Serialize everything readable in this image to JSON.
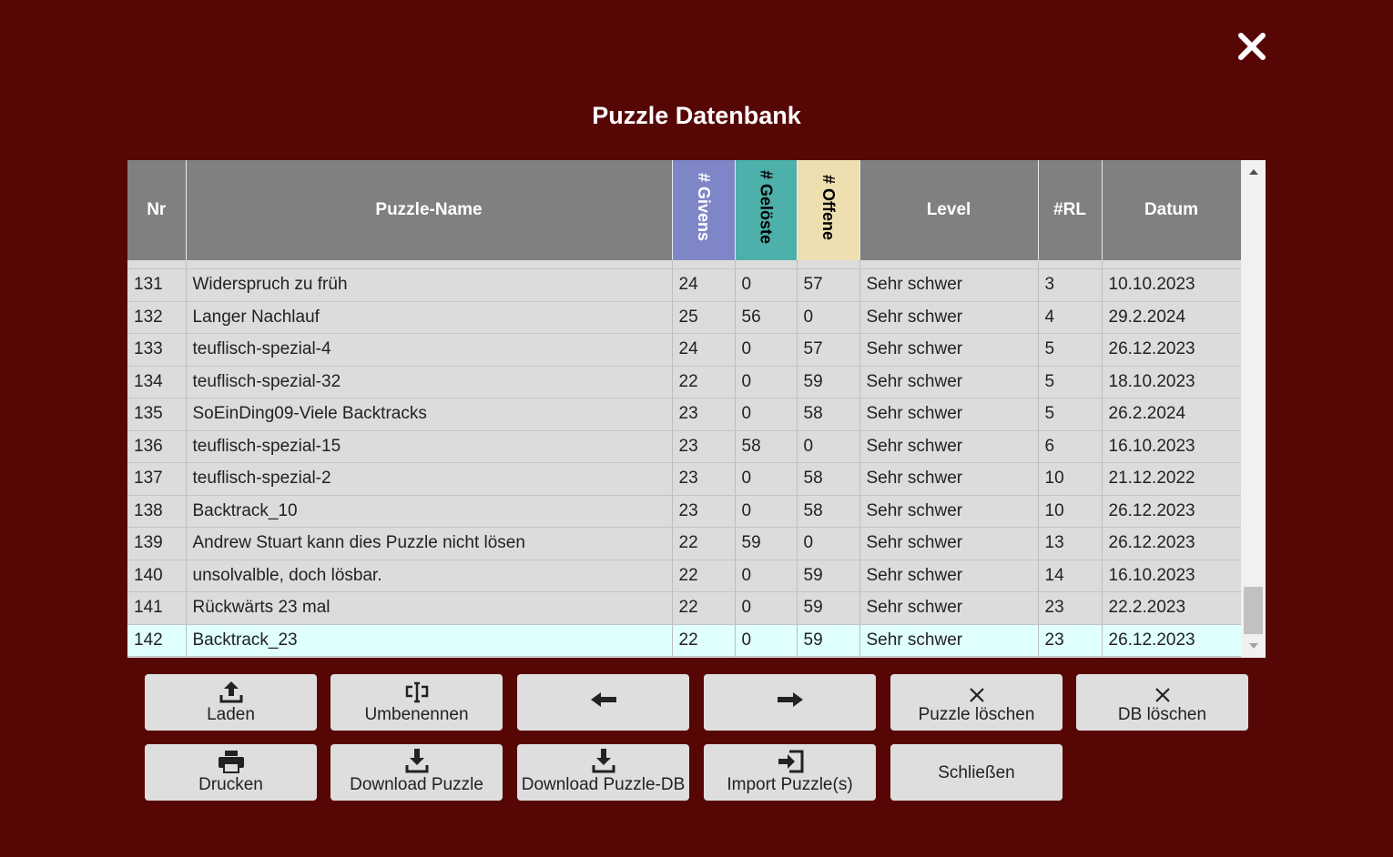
{
  "dialog": {
    "title": "Puzzle Datenbank"
  },
  "table": {
    "columns": [
      "Nr",
      "Puzzle-Name",
      "# Givens",
      "# Gelöste",
      "# Offene",
      "Level",
      "#RL",
      "Datum"
    ],
    "rows": [
      [
        "131",
        "Widerspruch zu früh",
        "24",
        "0",
        "57",
        "Sehr schwer",
        "3",
        "10.10.2023"
      ],
      [
        "132",
        "Langer Nachlauf",
        "25",
        "56",
        "0",
        "Sehr schwer",
        "4",
        "29.2.2024"
      ],
      [
        "133",
        "teuflisch-spezial-4",
        "24",
        "0",
        "57",
        "Sehr schwer",
        "5",
        "26.12.2023"
      ],
      [
        "134",
        "teuflisch-spezial-32",
        "22",
        "0",
        "59",
        "Sehr schwer",
        "5",
        "18.10.2023"
      ],
      [
        "135",
        "SoEinDing09-Viele Backtracks",
        "23",
        "0",
        "58",
        "Sehr schwer",
        "5",
        "26.2.2024"
      ],
      [
        "136",
        "teuflisch-spezial-15",
        "23",
        "58",
        "0",
        "Sehr schwer",
        "6",
        "16.10.2023"
      ],
      [
        "137",
        "teuflisch-spezial-2",
        "23",
        "0",
        "58",
        "Sehr schwer",
        "10",
        "21.12.2022"
      ],
      [
        "138",
        "Backtrack_10",
        "23",
        "0",
        "58",
        "Sehr schwer",
        "10",
        "26.12.2023"
      ],
      [
        "139",
        "Andrew Stuart kann dies Puzzle nicht lösen",
        "22",
        "59",
        "0",
        "Sehr schwer",
        "13",
        "26.12.2023"
      ],
      [
        "140",
        "unsolvalble, doch lösbar.",
        "22",
        "0",
        "59",
        "Sehr schwer",
        "14",
        "16.10.2023"
      ],
      [
        "141",
        "Rückwärts 23 mal",
        "22",
        "0",
        "59",
        "Sehr schwer",
        "23",
        "22.2.2023"
      ],
      [
        "142",
        "Backtrack_23",
        "22",
        "0",
        "59",
        "Sehr schwer",
        "23",
        "26.12.2023"
      ]
    ],
    "selected_nr": "142"
  },
  "buttons": {
    "laden": "Laden",
    "umbenennen": "Umbenennen",
    "puzzle_loeschen": "Puzzle löschen",
    "db_loeschen": "DB löschen",
    "drucken": "Drucken",
    "download_puzzle": "Download Puzzle",
    "download_db": "Download Puzzle-DB",
    "import": "Import Puzzle(s)",
    "schliessen": "Schließen"
  },
  "icons": {
    "close": "close-icon",
    "upload": "upload-icon",
    "rename": "rename-icon",
    "prev": "arrow-left-icon",
    "next": "arrow-right-icon",
    "delete": "x-icon",
    "print": "printer-icon",
    "download": "download-icon",
    "import": "import-icon"
  },
  "colors": {
    "background": "#560705",
    "header": "#808080",
    "givens": "#7f86c8",
    "geloeste": "#4eb0aa",
    "offene": "#eedfb1",
    "selected_row": "#e0ffff"
  }
}
